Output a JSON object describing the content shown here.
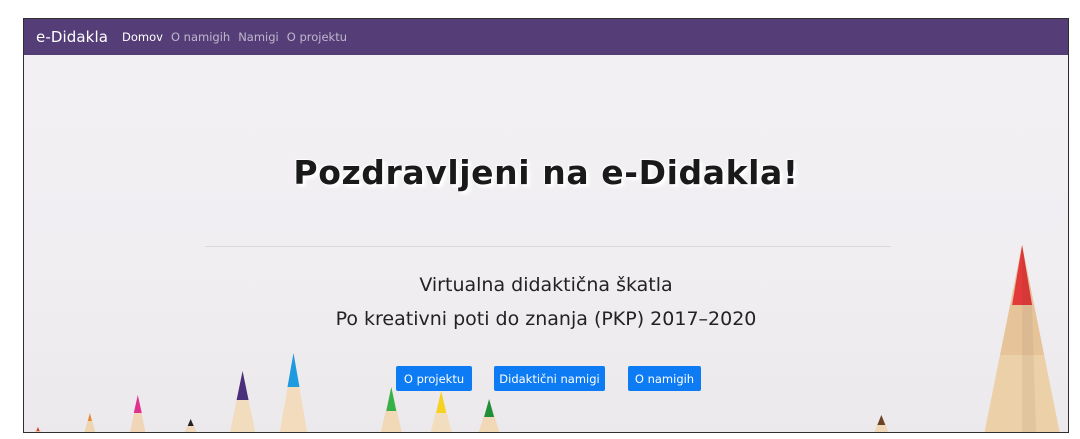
{
  "navbar": {
    "brand": "e-Didakla",
    "links": [
      {
        "label": "Domov",
        "active": true
      },
      {
        "label": "O namigih",
        "active": false
      },
      {
        "label": "Namigi",
        "active": false
      },
      {
        "label": "O projektu",
        "active": false
      }
    ],
    "background": "#553e78"
  },
  "hero": {
    "title": "Pozdravljeni na e-Didakla!",
    "subtitle_line1": "Virtualna didaktična škatla",
    "subtitle_line2": "Po kreativni poti do znanja (PKP) 2017–2020",
    "buttons": [
      {
        "label": "O projektu"
      },
      {
        "label": "Didaktični namigi"
      },
      {
        "label": "O namigih"
      }
    ],
    "button_color": "#0d7bf3",
    "background_image": "colored-pencils"
  }
}
